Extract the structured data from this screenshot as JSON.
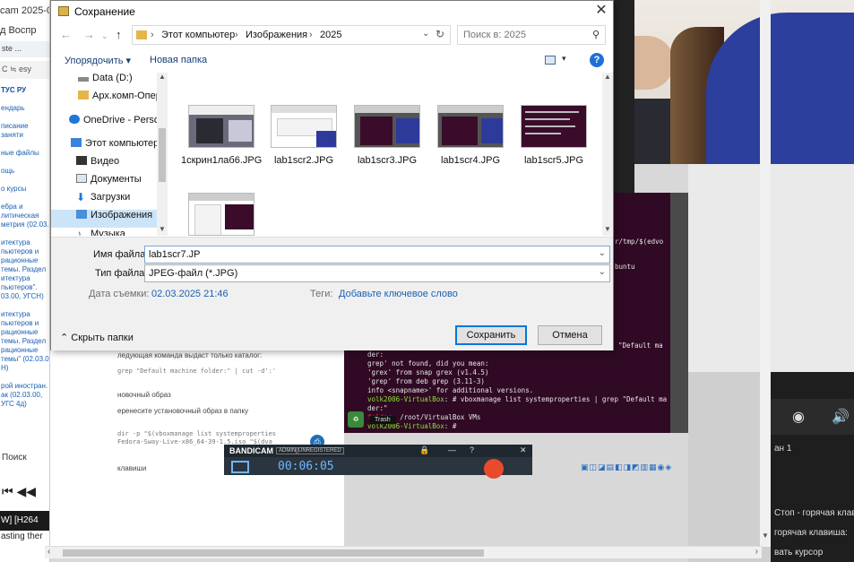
{
  "background": {
    "left": {
      "title": "cam 2025-0",
      "menu": "д  Воспр",
      "tab": "ste   ...",
      "addr": "C   ≒  esy",
      "nav_header": "ТУС РУ",
      "nav": [
        "ендарь",
        "писание заняти",
        "ные файлы",
        "ощь",
        "о курсы",
        "ебра и литическая метрия (02.03.",
        "итектура пьютеров и рационные темы. Раздел итектура пьютеров\". 03.00, УГСН)",
        "итектура пьютеров и рационные темы. Раздел рационные темы\" (02.03.0 Н)",
        "рой иностран. ак (02.03.00, УГС 4д)"
      ],
      "search": "Поиск",
      "media": "⏮  ◀◀",
      "black_bar": "W]   [H264",
      "pasting": "asting ther"
    },
    "doc": {
      "l1": "ледующая команда выдаст только каталог:",
      "l2": "grep \"Default machine folder:\" | cut -d':'",
      "l3": "новочный образ",
      "l4": "еренесите установочный образ в папку",
      "l5": "dir -p \"$(vboxmanage list systemproperties",
      "l6": "Fedora-Sway-Live-x86_64-39-1.5.iso \"$(dva",
      "l7": "клавиши"
    },
    "terminal": {
      "t1": "r/tmp/$(edvo",
      "t2": "buntu",
      "t3": "\"Default ma",
      "t4": "der:",
      "t5": "grep' not found, did you mean:",
      "t6": "  'grex' from snap grex (v1.4.5)",
      "t7": "  'grep' from deb grep (3.11-3)",
      "t8": " info <snapname>' for additional versions.",
      "t9_user": "volk2006-VirtualBox",
      "t9_cmd": ": # vboxmanage list systemproperties | grep \"Default ma",
      "t10": "der:\"",
      "t11_a": "folder:",
      "t11_b": "       /root/VirtualBox VMs",
      "t12_user": "volk2006-VirtualBox",
      "t12_cmd": ": # ",
      "trash_label": "Trash"
    },
    "bandicam": {
      "logo": "BANDICAM",
      "admin": "ADMIN",
      "unreg": "UNREGISTERED",
      "time": "00:06:05"
    },
    "right": {
      "line1": "ан 1",
      "line2": "Стоп - горячая клав",
      "line3": "горячая клавиша:",
      "line4": "вать курсор"
    }
  },
  "dialog": {
    "title": "Сохранение",
    "breadcrumb": [
      "Этот компьютер",
      "Изображения",
      "2025"
    ],
    "search_placeholder": "Поиск в: 2025",
    "toolbar": {
      "organize": "Упорядочить ▾",
      "new_folder": "Новая папка",
      "help": "?"
    },
    "nav_items": [
      {
        "label": "Data (D:)",
        "icon": "drive-icon"
      },
      {
        "label": "Арх.комп-Опер",
        "icon": "folder-icon"
      },
      {
        "label": "OneDrive - Person",
        "icon": "cloud-icon"
      },
      {
        "label": "Этот компьютер",
        "icon": "computer-icon"
      },
      {
        "label": "Видео",
        "icon": "video-icon"
      },
      {
        "label": "Документы",
        "icon": "documents-icon"
      },
      {
        "label": "Загрузки",
        "icon": "download-icon"
      },
      {
        "label": "Изображения",
        "icon": "pictures-icon"
      },
      {
        "label": "Музыка",
        "icon": "music-icon"
      }
    ],
    "files": [
      {
        "name": "1скрин1лаб6.JPG"
      },
      {
        "name": "lab1scr2.JPG"
      },
      {
        "name": "lab1scr3.JPG"
      },
      {
        "name": "lab1scr4.JPG"
      },
      {
        "name": "lab1scr5.JPG"
      },
      {
        "name": ""
      }
    ],
    "filename_label": "Имя файла:",
    "filename_value": "lab1scr7.JP",
    "filetype_label": "Тип файла:",
    "filetype_value": "JPEG-файл (*.JPG)",
    "date_label": "Дата съемки:",
    "date_value": "02.03.2025 21:46",
    "tags_label": "Теги:",
    "tags_value": "Добавьте ключевое слово",
    "hide_folders": "Скрыть папки",
    "save_label": "Сохранить",
    "cancel_label": "Отмена"
  }
}
